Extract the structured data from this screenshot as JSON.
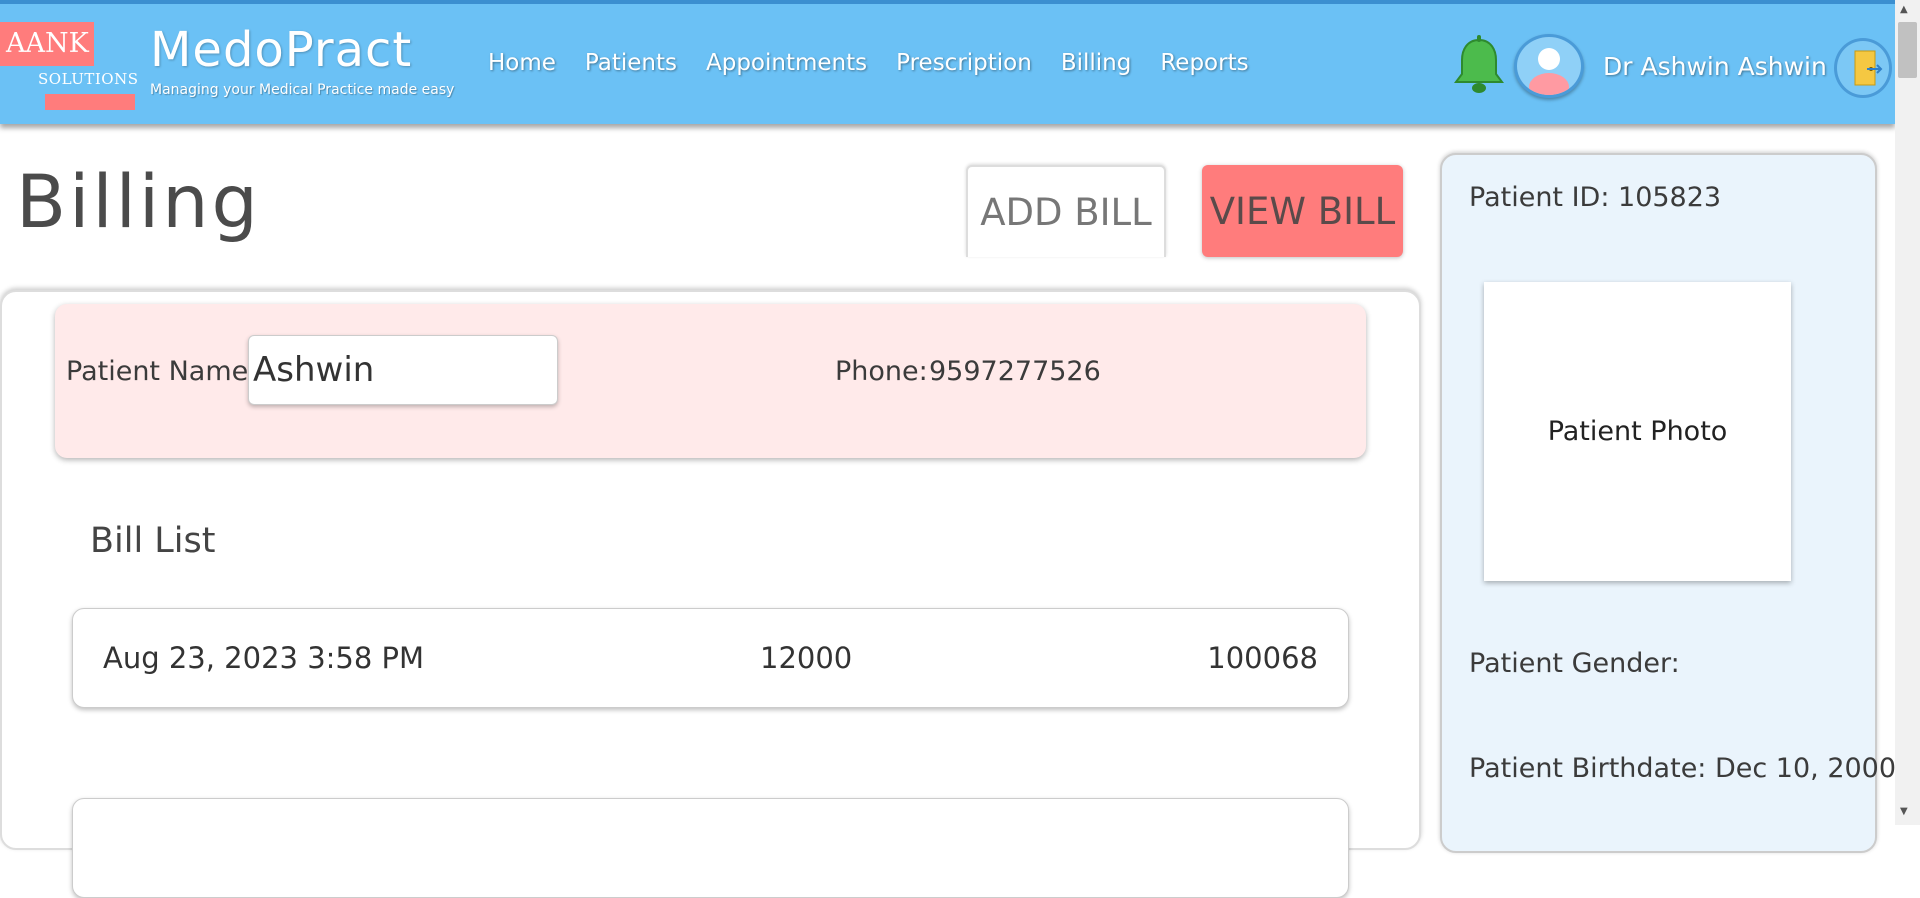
{
  "header": {
    "logo_top": "AANK",
    "logo_bottom": "SOLUTIONS",
    "brand": "MedoPract",
    "tagline": "Managing your Medical Practice made easy",
    "nav": [
      {
        "label": "Home"
      },
      {
        "label": "Patients"
      },
      {
        "label": "Appointments"
      },
      {
        "label": "Prescription"
      },
      {
        "label": "Billing"
      },
      {
        "label": "Reports"
      }
    ],
    "doctor_name": "Dr  Ashwin  Ashwin",
    "colors": {
      "header_bg": "#6bc1f5",
      "accent": "#ff7c7c",
      "bell": "#4cbb4c"
    }
  },
  "page": {
    "title": "Billing",
    "add_bill_label": "ADD BILL",
    "view_bill_label": "VIEW BILL"
  },
  "patient": {
    "name_label": "Patient Name:",
    "name_value": "Ashwin",
    "phone_label": "Phone:",
    "phone_value": "9597277526"
  },
  "bills": {
    "title": "Bill List",
    "rows": [
      {
        "date": "Aug 23, 2023 3:58 PM",
        "amount": "12000",
        "id": "100068"
      },
      {
        "date": "",
        "amount": "",
        "id": ""
      }
    ]
  },
  "side": {
    "patient_id": "Patient ID: 105823",
    "photo_label": "Patient Photo",
    "gender": "Patient Gender:",
    "birthdate": "Patient Birthdate: Dec 10, 2000"
  }
}
